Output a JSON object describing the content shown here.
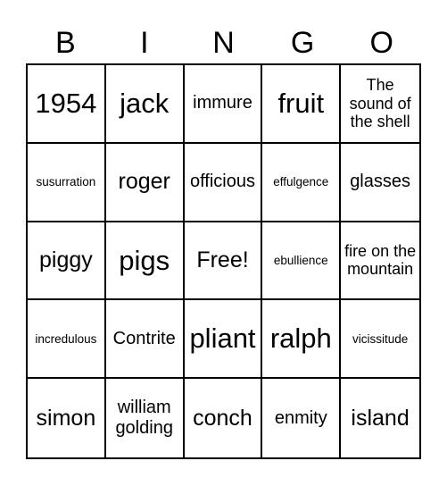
{
  "header": [
    "B",
    "I",
    "N",
    "G",
    "O"
  ],
  "grid": [
    [
      "1954",
      "jack",
      "immure",
      "fruit",
      "The sound of the shell"
    ],
    [
      "susurration",
      "roger",
      "officious",
      "effulgence",
      "glasses"
    ],
    [
      "piggy",
      "pigs",
      "Free!",
      "ebullience",
      "fire on the mountain"
    ],
    [
      "incredulous",
      "Contrite",
      "pliant",
      "ralph",
      "vicissitude"
    ],
    [
      "simon",
      "william golding",
      "conch",
      "enmity",
      "island"
    ]
  ]
}
